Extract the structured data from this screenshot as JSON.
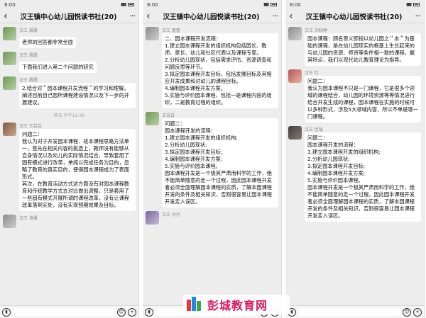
{
  "panels": [
    {
      "status_time": "8:00",
      "title": "汉王镇中心幼儿园悦读书社(20)",
      "messages": [
        {
          "sender": "汉王 晨晨",
          "avatar": "av-green",
          "text": "老师的回答都非常全面"
        },
        {
          "sender": "汉王 晨晨",
          "avatar": "av-green",
          "text": "下面我们进入第二个问题的研究"
        },
        {
          "sender": "汉王 晨晨",
          "avatar": "av-green",
          "text": "2.结合对＂园本课程开发流程＂的学习和理解，阐述目前自己园所课程建设情况以及下一步的开展建议。"
        },
        {
          "sender": "汉王 王芸芸",
          "avatar": "av-brown",
          "text": "问题二：\n我认为对于开发园本课程、班本课程思路方法单一，首先在相关内容的挑选上，教师没有能够从自身情况以及幼儿的实际情况结合，导致套用了固有模式进行改革，单纯以完成任务为目的，忽略了教育的真实目的，使得园本课程成为了表面形式。\n其次，在教育活动方式这方面没有对园本课程教育和传统教学方式去对比做出调整，只是套用了一些固有模式开展所谓的课程改革，没有让课程改革落到实处，没有实现预期效果及目标。"
        },
        {
          "sender": "汉王 涛雅",
          "avatar": "av-gray",
          "text": ""
        }
      ],
      "timestamp": "昨天 中午12:42"
    },
    {
      "status_time": "8:00",
      "title": "汉王镇中心幼儿园悦读书社(20)",
      "messages": [
        {
          "sender": "汉王 蕾蕾",
          "avatar": "av-gray",
          "text": "二、园本课程开发流程：\n1.建立园本课程开发的组织机构包括园长、教师、家长、幼儿和社区代表以及课程专家。\n2.分析幼儿园现状，包括需求评估、资源调查和问题反思等环节。\n3.拟定园本课程开发目标，包括发展目标及其相应开发成果和对幼儿的课程目标。\n4.编制园本课程开发方案。\n5.实施与评价园本课程，包括一是课程内容的组织，二是教育过程的组织。"
        },
        {
          "sender": "王涓日",
          "avatar": "av-green",
          "text": "问题二：\n园本课程开发的流程：\n1.建立园本课程开发的组织机构;\n2.分析幼儿园现状;\n3.拟定园本课程开发目标;\n4.编制园本课程开发方案;\n5.实施与评价园本课程。\n园本课程开发是一个极其严肃而科学的工作，绝不能简单随意的走一个过程，因此园本课程开发者必须全面理解园本课程的实质，了解本园课程开发的条件及相关知识，否则很容易让园本课程开发走入误区。"
        },
        {
          "sender": "汉王 孙丹",
          "avatar": "av-purple",
          "text": ""
        }
      ]
    },
    {
      "status_time": "8:00",
      "title": "汉王镇中心幼儿园悦读书社(20)",
      "messages": [
        {
          "sender": "汉王 刘晓婷",
          "avatar": "av-gray",
          "text": "园本课程：顾名思义即指以幼儿园之＂本＂为基础的课程，是在幼儿园现实的根基上生长起来的与幼儿园的资源、师资等条件相一致的课程，据其特点，我们以现代幼儿教育理论为指导。"
        },
        {
          "sender": "汉王 红",
          "avatar": "av-red",
          "text": "问题二：\n我认为园本课程不只是一门课程，它是很多个领域的课程结合，幼儿园的环境资源等等情况进行结合开发生成的课程，园本课程在实施的时候可以多种形式，涉及5大领域内容，所以不单是哪一门课程。"
        },
        {
          "sender": "汉王 佳瑞",
          "avatar": "av-dark",
          "text": "问题二：\n园本课程开发的流程：\n1.建立园本课程开发的组织机构;\n2.分析幼儿园现状;\n3.拟定园本课程开发目标;\n4.编制园本课程开发方案;\n5.实施与评价园本课程。\n园本课程开发是一个极其严肃而科学的工作，绝不能简单随意的走一个过程，因此园本课程开发者必须全面理解园本课程的实质，了解本园课程开发的条件及相关知识，否则很容易让园本课程开发走入误区。"
        }
      ]
    }
  ],
  "watermark": {
    "text": "彭城教育网"
  }
}
